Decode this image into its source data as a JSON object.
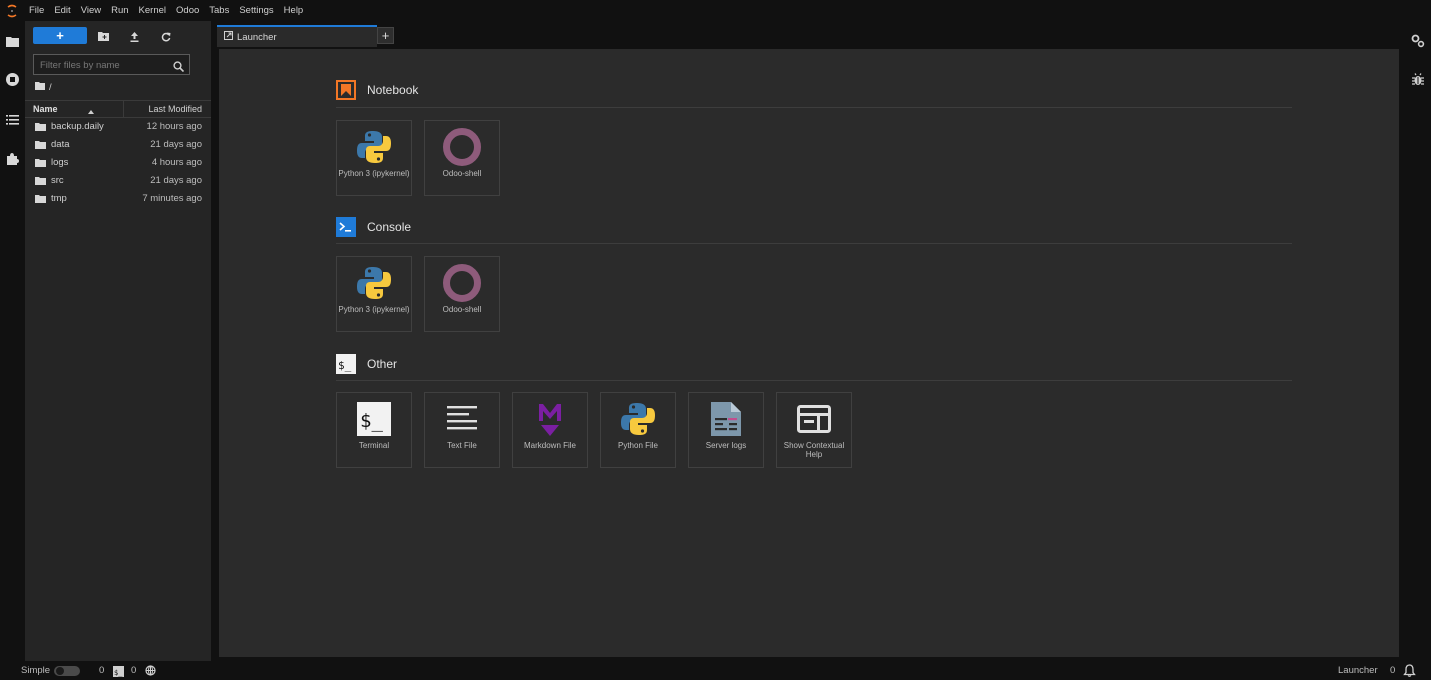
{
  "menu": [
    "File",
    "Edit",
    "View",
    "Run",
    "Kernel",
    "Odoo",
    "Tabs",
    "Settings",
    "Help"
  ],
  "filebrowser": {
    "new_button_label": "+",
    "filter_placeholder": "Filter files by name",
    "breadcrumb": "/",
    "columns": {
      "name": "Name",
      "modified": "Last Modified"
    },
    "files": [
      {
        "name": "backup.daily",
        "modified": "12 hours ago"
      },
      {
        "name": "data",
        "modified": "21 days ago"
      },
      {
        "name": "logs",
        "modified": "4 hours ago"
      },
      {
        "name": "src",
        "modified": "21 days ago"
      },
      {
        "name": "tmp",
        "modified": "7 minutes ago"
      }
    ]
  },
  "tabs": [
    {
      "label": "Launcher"
    }
  ],
  "add_tab_label": "+",
  "launcher": {
    "notebook": {
      "title": "Notebook",
      "items": [
        {
          "label": "Python 3 (ipykernel)"
        },
        {
          "label": "Odoo-shell"
        }
      ]
    },
    "console": {
      "title": "Console",
      "items": [
        {
          "label": "Python 3 (ipykernel)"
        },
        {
          "label": "Odoo-shell"
        }
      ]
    },
    "other": {
      "title": "Other",
      "items": [
        {
          "label": "Terminal"
        },
        {
          "label": "Text File"
        },
        {
          "label": "Markdown File"
        },
        {
          "label": "Python File"
        },
        {
          "label": "Server logs"
        },
        {
          "label": "Show Contextual Help"
        }
      ]
    }
  },
  "status": {
    "mode_label": "Simple",
    "kernels_count": "0",
    "terminals_count": "0",
    "current_label": "Launcher",
    "notifications_count": "0"
  },
  "colors": {
    "accent": "#1f7bd8",
    "odoo": "#8e5b7b",
    "notebook_icon": "#f37726",
    "markdown": "#7b1fa2"
  }
}
